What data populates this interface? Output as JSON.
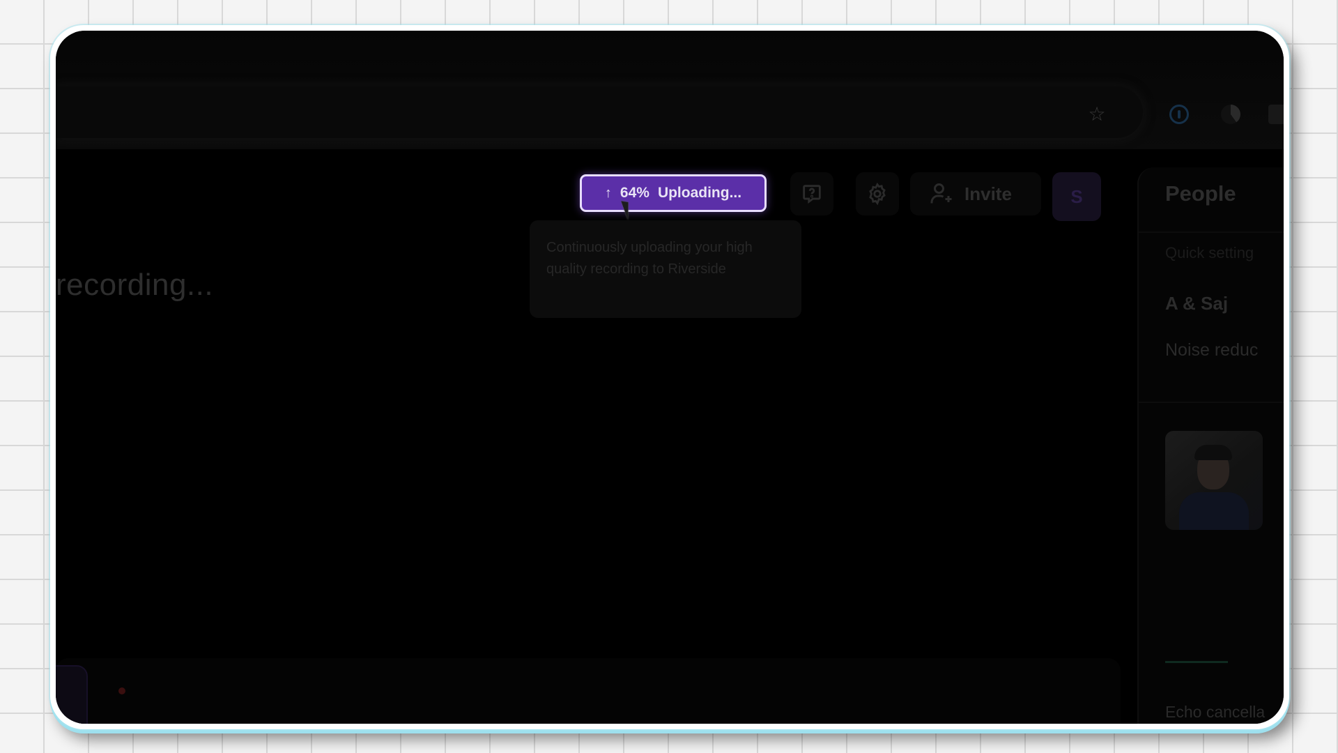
{
  "upload": {
    "percent_label": "64%",
    "status_label": "Uploading...",
    "progress_percent": 64,
    "tooltip": "Continuously uploading your high quality recording to Riverside",
    "accent_color": "#5b2fa8"
  },
  "stage": {
    "status_text": "recording..."
  },
  "toolbar": {
    "help_icon": "help-chat-icon",
    "settings_icon": "gear-icon",
    "invite_label": "Invite",
    "avatar_initial": "S"
  },
  "side_panel": {
    "title": "People",
    "quick_settings": "Quick setting",
    "participant_name": "A & Saj",
    "noise_label": "Noise reduc",
    "echo_label": "Echo cancella"
  }
}
